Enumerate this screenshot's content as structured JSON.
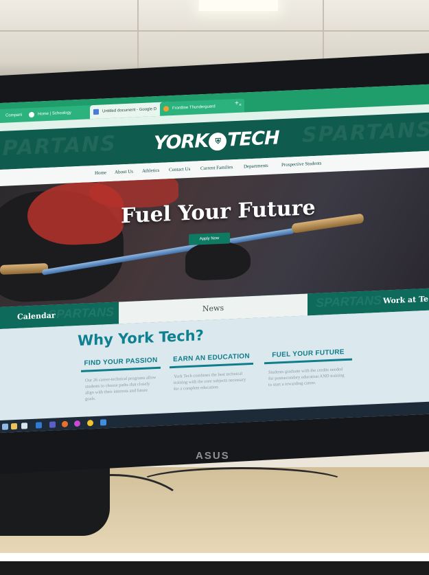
{
  "browser": {
    "tabs": [
      {
        "label": "Compani"
      },
      {
        "label": "Home | Schoology"
      },
      {
        "label": "Untitled document - Google D"
      },
      {
        "label": "Frontline Thunderguard"
      }
    ],
    "new_tab": "+"
  },
  "site": {
    "logo_left": "YORK",
    "logo_right": "TECH",
    "watermark": "SPARTANS",
    "nav": [
      "Home",
      "About Us",
      "Athletics",
      "Contact Us",
      "Current Families",
      "Departments",
      "Prospective Students"
    ],
    "hero": {
      "title": "Fuel Your Future",
      "button": "Apply Now"
    },
    "strip": {
      "left": "Calendar",
      "center": "News",
      "right": "Work at Te"
    },
    "why": {
      "title": "Why York Tech?",
      "columns": [
        {
          "heading": "FIND YOUR PASSION",
          "body": "Our 26 career-technical programs allow students to choose paths that closely align with their interests and future goals."
        },
        {
          "heading": "EARN AN EDUCATION",
          "body": "York Tech combines the best technical training with the core subjects necessary for a complete education."
        },
        {
          "heading": "FUEL YOUR FUTURE",
          "body": "Students graduate with the credits needed for postsecondary education AND training to start a rewarding career."
        }
      ]
    }
  },
  "monitor": {
    "brand": "ASUS"
  },
  "colors": {
    "header": "#0f5b4d",
    "accent": "#0f7d8a",
    "tabbar": "#1f9e6b"
  }
}
